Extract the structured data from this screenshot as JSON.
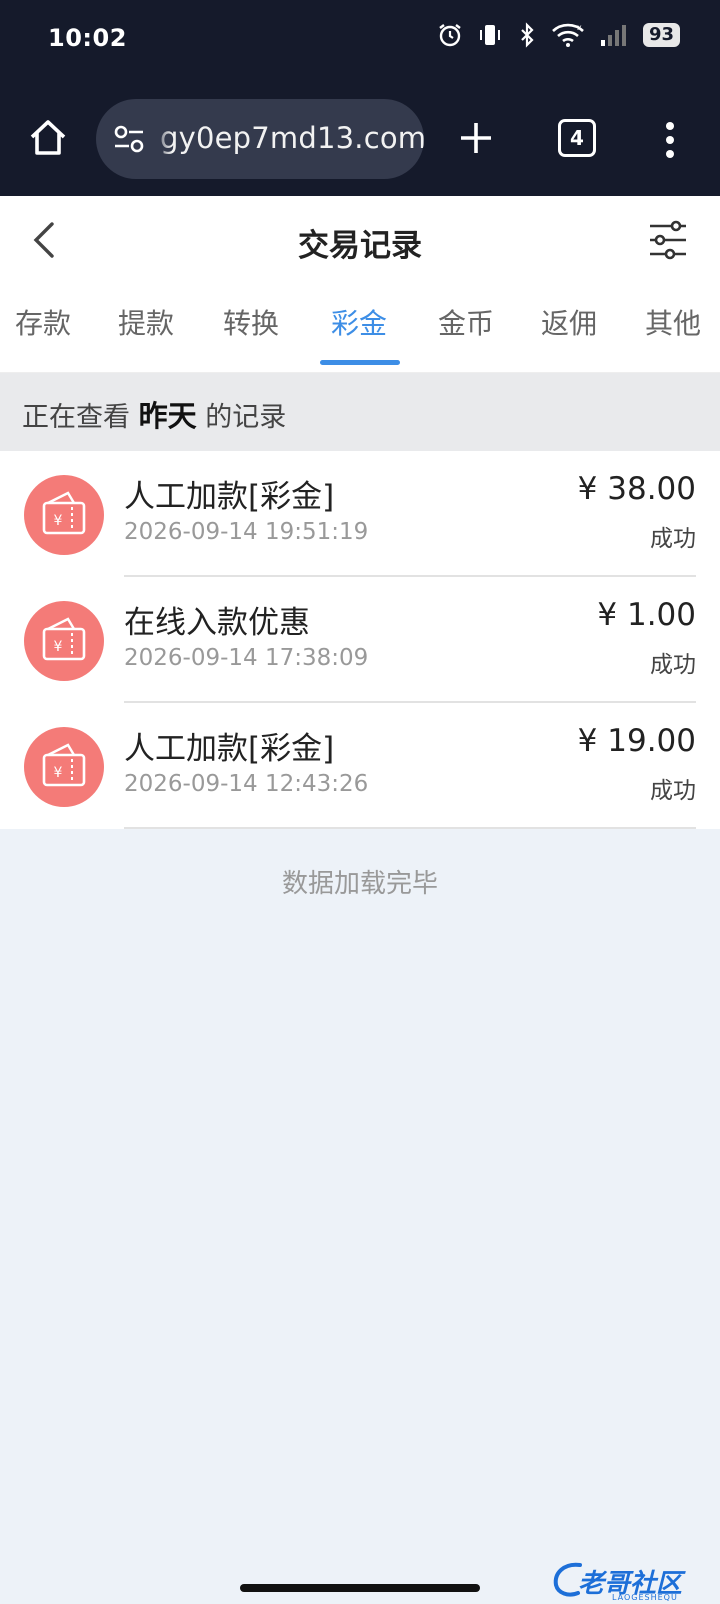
{
  "status_bar": {
    "time": "10:02",
    "battery": "93",
    "icons": [
      "alarm-icon",
      "vibrate-icon",
      "bluetooth-icon",
      "wifi-icon",
      "signal-icon"
    ]
  },
  "browser": {
    "url": "gy0ep7md13.com",
    "tab_count": "4",
    "icons": [
      "home-icon",
      "site-settings-icon",
      "plus-icon",
      "tabs-icon",
      "more-vert-icon"
    ]
  },
  "header": {
    "title": "交易记录",
    "back_icon": "chevron-left-icon",
    "filter_icon": "sliders-icon"
  },
  "tabs": [
    {
      "label": "存款"
    },
    {
      "label": "提款"
    },
    {
      "label": "转换"
    },
    {
      "label": "彩金",
      "active": true
    },
    {
      "label": "金币"
    },
    {
      "label": "返佣"
    },
    {
      "label": "其他"
    }
  ],
  "viewing": {
    "prefix": "正在查看",
    "period": "昨天",
    "suffix": "的记录"
  },
  "records": [
    {
      "title": "人工加款[彩金]",
      "time": "2026-09-14 19:51:19",
      "amount": "¥ 38.00",
      "status": "成功"
    },
    {
      "title": "在线入款优惠",
      "time": "2026-09-14 17:38:09",
      "amount": "¥ 1.00",
      "status": "成功"
    },
    {
      "title": "人工加款[彩金]",
      "time": "2026-09-14 12:43:26",
      "amount": "¥ 19.00",
      "status": "成功"
    }
  ],
  "footer_text": "数据加载完毕",
  "watermark": {
    "text": "老哥社区",
    "sub": "LAOGESHEQU"
  },
  "colors": {
    "accent": "#3d8ee6",
    "icon_circle": "#f47b78",
    "chrome_bg": "#151a2b",
    "page_bg": "#edf2f8"
  }
}
